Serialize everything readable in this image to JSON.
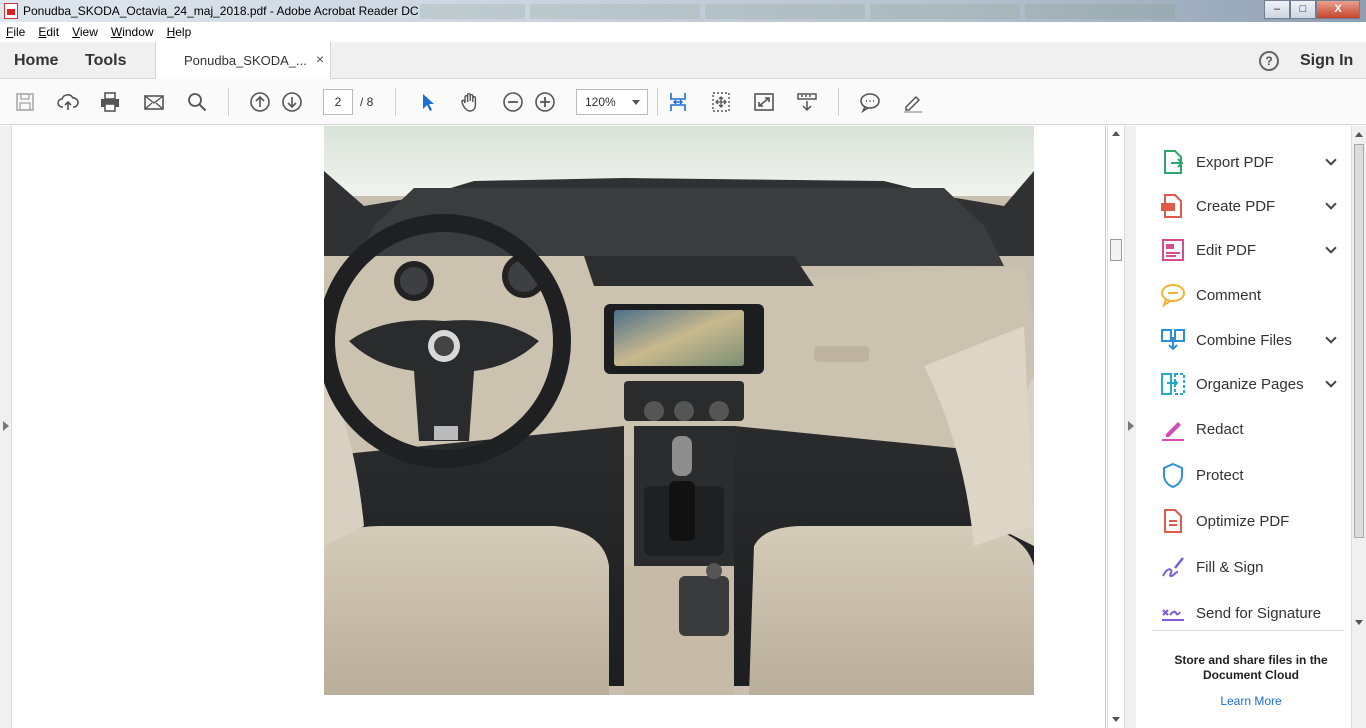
{
  "window": {
    "title": "Ponudba_SKODA_Octavia_24_maj_2018.pdf - Adobe Acrobat Reader DC",
    "buttons": {
      "minimize": "–",
      "maximize": "□",
      "close": "X"
    }
  },
  "menu": [
    "File",
    "Edit",
    "View",
    "Window",
    "Help"
  ],
  "tabs": {
    "home": "Home",
    "tools": "Tools",
    "document": "Ponudba_SKODA_...",
    "close_glyph": "×",
    "help_glyph": "?",
    "sign_in": "Sign In"
  },
  "toolbar": {
    "current_page": "2",
    "total_pages": "/ 8",
    "zoom": "120%"
  },
  "tools_pane": {
    "items": [
      {
        "label": "Export PDF",
        "expandable": true,
        "icon": "export-pdf-icon",
        "color": "#2da86a"
      },
      {
        "label": "Create PDF",
        "expandable": true,
        "icon": "create-pdf-icon",
        "color": "#e05a4a"
      },
      {
        "label": "Edit PDF",
        "expandable": true,
        "icon": "edit-pdf-icon",
        "color": "#d44d8c"
      },
      {
        "label": "Comment",
        "expandable": false,
        "icon": "comment-icon",
        "color": "#f2b531"
      },
      {
        "label": "Combine Files",
        "expandable": true,
        "icon": "combine-files-icon",
        "color": "#2c8fd8"
      },
      {
        "label": "Organize Pages",
        "expandable": true,
        "icon": "organize-pages-icon",
        "color": "#27a8c9"
      },
      {
        "label": "Redact",
        "expandable": false,
        "icon": "redact-icon",
        "color": "#d44db5"
      },
      {
        "label": "Protect",
        "expandable": false,
        "icon": "protect-icon",
        "color": "#2c8fd8"
      },
      {
        "label": "Optimize PDF",
        "expandable": false,
        "icon": "optimize-pdf-icon",
        "color": "#e05a4a"
      },
      {
        "label": "Fill & Sign",
        "expandable": false,
        "icon": "fill-sign-icon",
        "color": "#7b5fd6"
      },
      {
        "label": "Send for Signature",
        "expandable": false,
        "icon": "send-signature-icon",
        "color": "#7b5fd6"
      }
    ],
    "cloud_title": "Store and share files in the Document Cloud",
    "learn_more": "Learn More"
  }
}
